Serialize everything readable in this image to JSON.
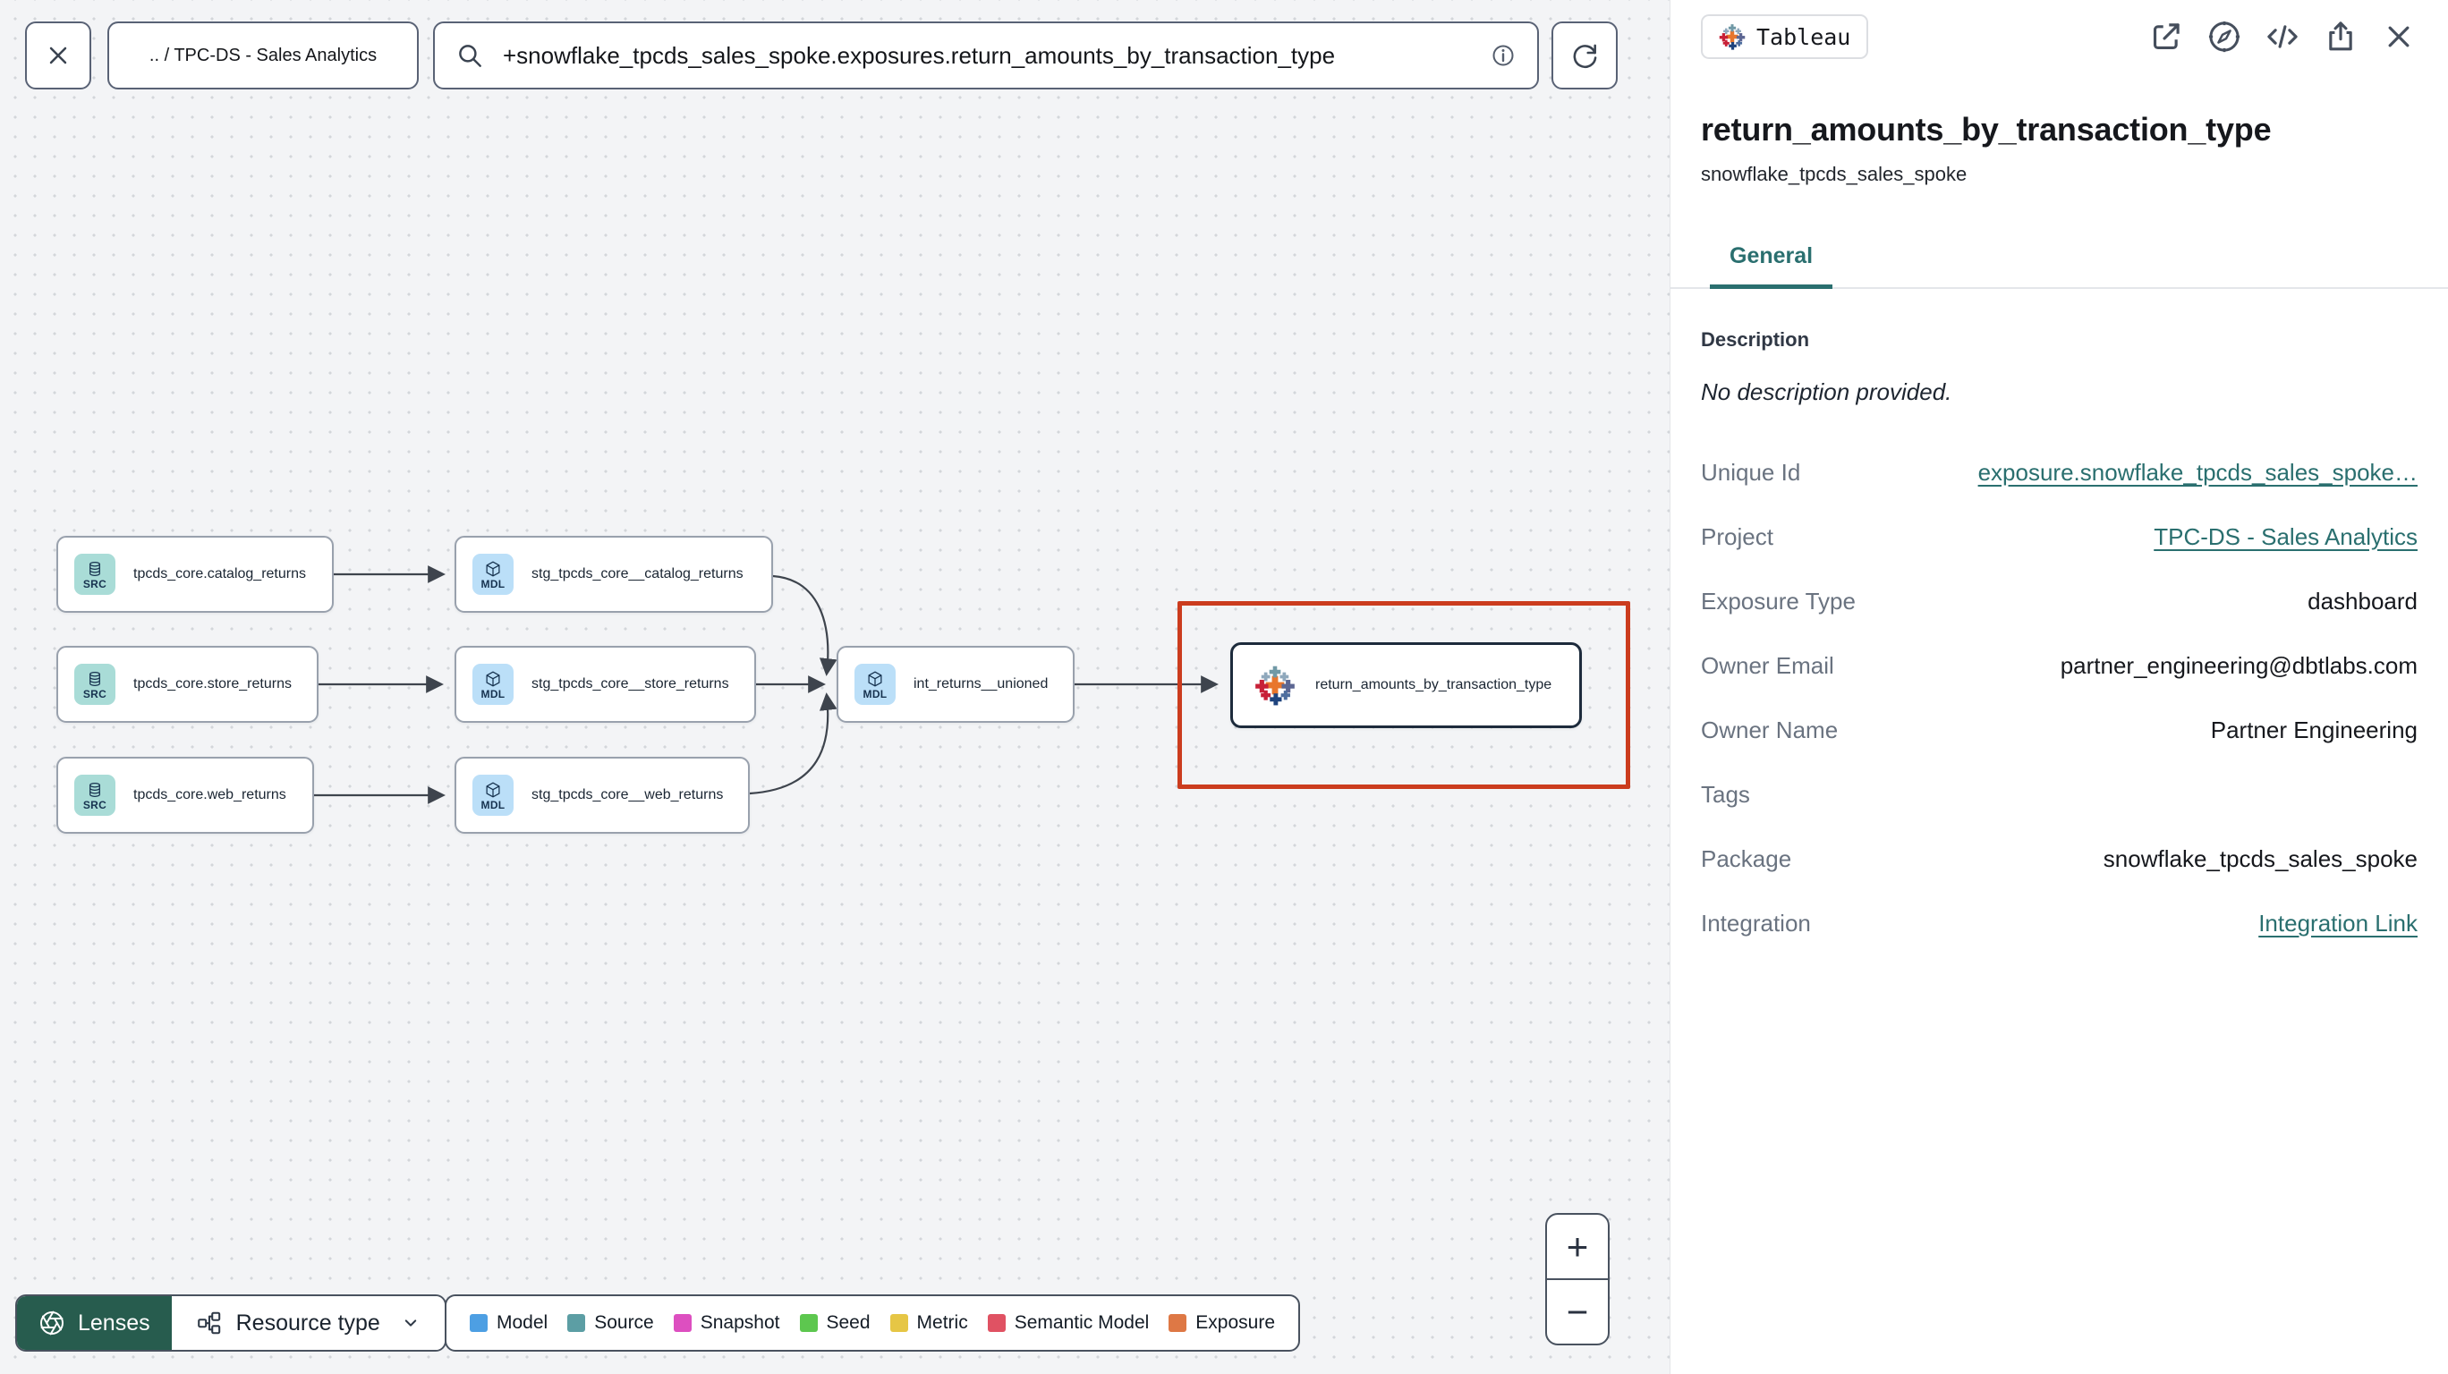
{
  "toolbar": {
    "breadcrumb": ".. / TPC-DS - Sales Analytics",
    "search_value": "+snowflake_tpcds_sales_spoke.exposures.return_amounts_by_transaction_type",
    "icons": [
      "close-icon",
      "search-icon",
      "info-icon",
      "refresh-icon"
    ]
  },
  "graph": {
    "nodes": [
      {
        "type": "source",
        "badge": "SRC",
        "label": "tpcds_core.catalog_returns"
      },
      {
        "type": "model",
        "badge": "MDL",
        "label": "stg_tpcds_core__catalog_returns"
      },
      {
        "type": "source",
        "badge": "SRC",
        "label": "tpcds_core.store_returns"
      },
      {
        "type": "model",
        "badge": "MDL",
        "label": "stg_tpcds_core__store_returns"
      },
      {
        "type": "model",
        "badge": "MDL",
        "label": "int_returns__unioned"
      },
      {
        "type": "source",
        "badge": "SRC",
        "label": "tpcds_core.web_returns"
      },
      {
        "type": "model",
        "badge": "MDL",
        "label": "stg_tpcds_core__web_returns"
      },
      {
        "type": "exposure",
        "icon": "tableau-icon",
        "label": "return_amounts_by_transaction_type",
        "selected": true
      }
    ],
    "edges": [
      {
        "from": "tpcds_core.catalog_returns",
        "to": "stg_tpcds_core__catalog_returns"
      },
      {
        "from": "tpcds_core.store_returns",
        "to": "stg_tpcds_core__store_returns"
      },
      {
        "from": "tpcds_core.web_returns",
        "to": "stg_tpcds_core__web_returns"
      },
      {
        "from": "stg_tpcds_core__catalog_returns",
        "to": "int_returns__unioned"
      },
      {
        "from": "stg_tpcds_core__store_returns",
        "to": "int_returns__unioned"
      },
      {
        "from": "stg_tpcds_core__web_returns",
        "to": "int_returns__unioned"
      },
      {
        "from": "int_returns__unioned",
        "to": "return_amounts_by_transaction_type"
      }
    ]
  },
  "panel": {
    "integration_badge": "Tableau",
    "header_icons": [
      "external-link-icon",
      "compass-icon",
      "code-icon",
      "share-icon",
      "close-icon"
    ],
    "title": "return_amounts_by_transaction_type",
    "subtitle": "snowflake_tpcds_sales_spoke",
    "tab": "General",
    "description_heading": "Description",
    "description_empty": "No description provided.",
    "fields": [
      {
        "label": "Unique Id",
        "value": "exposure.snowflake_tpcds_sales_spoke…",
        "link": true
      },
      {
        "label": "Project",
        "value": "TPC-DS - Sales Analytics",
        "link": true
      },
      {
        "label": "Exposure Type",
        "value": "dashboard",
        "link": false
      },
      {
        "label": "Owner Email",
        "value": "partner_engineering@dbtlabs.com",
        "link": false
      },
      {
        "label": "Owner Name",
        "value": "Partner Engineering",
        "link": false
      },
      {
        "label": "Tags",
        "value": "",
        "link": false
      },
      {
        "label": "Package",
        "value": "snowflake_tpcds_sales_spoke",
        "link": false
      },
      {
        "label": "Integration",
        "value": "Integration Link",
        "link": true
      }
    ]
  },
  "footer": {
    "lenses_label": "Lenses",
    "resource_type_label": "Resource type",
    "legend": [
      {
        "label": "Model",
        "color": "#4D9FE3"
      },
      {
        "label": "Source",
        "color": "#5C9EA4"
      },
      {
        "label": "Snapshot",
        "color": "#DD4FC0"
      },
      {
        "label": "Seed",
        "color": "#5DC74F"
      },
      {
        "label": "Metric",
        "color": "#E6C645"
      },
      {
        "label": "Semantic Model",
        "color": "#E05263"
      },
      {
        "label": "Exposure",
        "color": "#DE7845"
      }
    ]
  },
  "zoom_controls": {
    "zoom_in": "+",
    "zoom_out": "−"
  },
  "colors": {
    "accent_teal": "#2A6F6F",
    "selection_red": "#CB3C1E",
    "source_badge": "#A9DCD7",
    "model_badge": "#BBDFF8",
    "lenses_green": "#275C4E",
    "tableau_logo": [
      "#E8762D",
      "#C72037",
      "#5C6692",
      "#7099A6",
      "#1F447E",
      "#8FA8BC",
      "#8FA8BC",
      "#C72037",
      "#4E6E9E"
    ]
  }
}
